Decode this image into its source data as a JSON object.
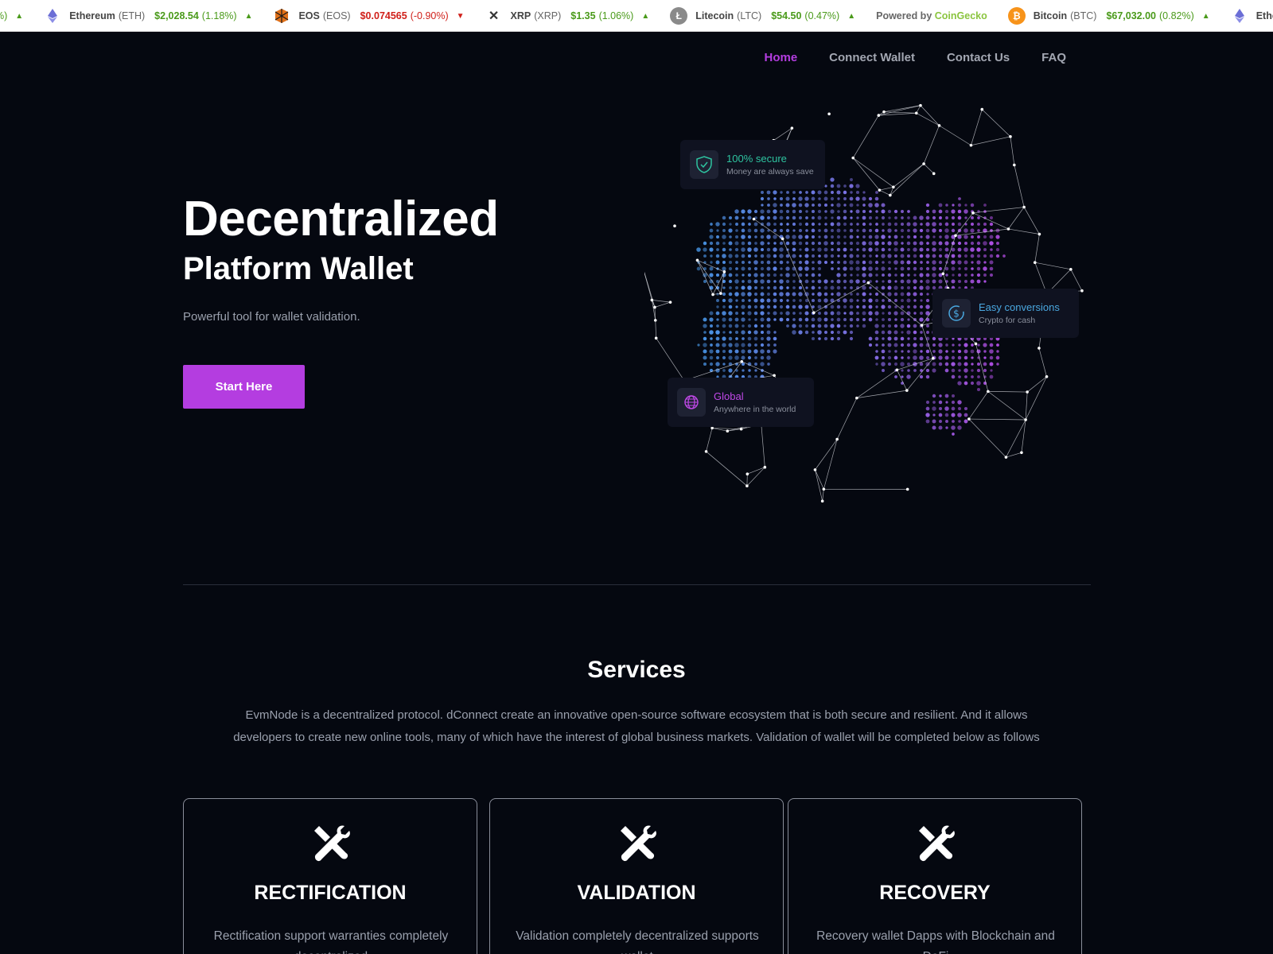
{
  "ticker": {
    "items": [
      {
        "name": "",
        "symbol": "",
        "price": "",
        "change": "%)",
        "dir": "up",
        "icon": "none"
      },
      {
        "name": "Ethereum",
        "symbol": "(ETH)",
        "price": "$2,028.54",
        "change": "(1.18%)",
        "dir": "up",
        "icon": "ethereum-icon",
        "color": "#6b6ed6"
      },
      {
        "name": "EOS",
        "symbol": "(EOS)",
        "price": "$0.074565",
        "change": "(-0.90%)",
        "dir": "down",
        "icon": "eos-icon",
        "color": "#e0711a"
      },
      {
        "name": "XRP",
        "symbol": "(XRP)",
        "price": "$1.35",
        "change": "(1.06%)",
        "dir": "up",
        "icon": "xrp-icon",
        "color": "#333333"
      },
      {
        "name": "Litecoin",
        "symbol": "(LTC)",
        "price": "$54.50",
        "change": "(0.47%)",
        "dir": "up",
        "icon": "litecoin-icon",
        "color": "#8a8a8a"
      }
    ],
    "powered_by": "Powered by",
    "powered_brand": "CoinGecko",
    "items_after": [
      {
        "name": "Bitcoin",
        "symbol": "(BTC)",
        "price": "$67,032.00",
        "change": "(0.82%)",
        "dir": "up",
        "icon": "bitcoin-icon",
        "color": "#f7931a"
      },
      {
        "name": "Ethere",
        "symbol": "",
        "price": "",
        "change": "",
        "dir": "",
        "icon": "ethereum-icon",
        "color": "#6b6ed6"
      }
    ]
  },
  "nav": {
    "items": [
      "Home",
      "Connect Wallet",
      "Contact Us",
      "FAQ"
    ],
    "active": "Home"
  },
  "hero": {
    "title": "Decentralized",
    "subtitle": "Platform Wallet",
    "description": "Powerful tool for wallet validation.",
    "cta": "Start Here"
  },
  "badges": {
    "secure": {
      "title": "100% secure",
      "sub": "Money are always save",
      "color": "#2ec4a0"
    },
    "conversions": {
      "title": "Easy conversions",
      "sub": "Crypto for cash",
      "color": "#4aa8e0"
    },
    "global": {
      "title": "Global",
      "sub": "Anywhere in the world",
      "color": "#c048e8"
    }
  },
  "services": {
    "title": "Services",
    "description": "EvmNode is a decentralized protocol. dConnect create an innovative open-source software ecosystem that is both secure and resilient. And it allows developers to create new online tools, many of which have the interest of global business markets. Validation of wallet will be completed below as follows",
    "cards": [
      {
        "title": "RECTIFICATION",
        "text": "Rectification support warranties completely decentralized"
      },
      {
        "title": "VALIDATION",
        "text": "Validation completely decentralized supports wallet"
      },
      {
        "title": "RECOVERY",
        "text": "Recovery wallet Dapps with Blockchain and DeFi"
      }
    ]
  },
  "colors": {
    "accent": "#b43de0",
    "background": "#050810"
  }
}
